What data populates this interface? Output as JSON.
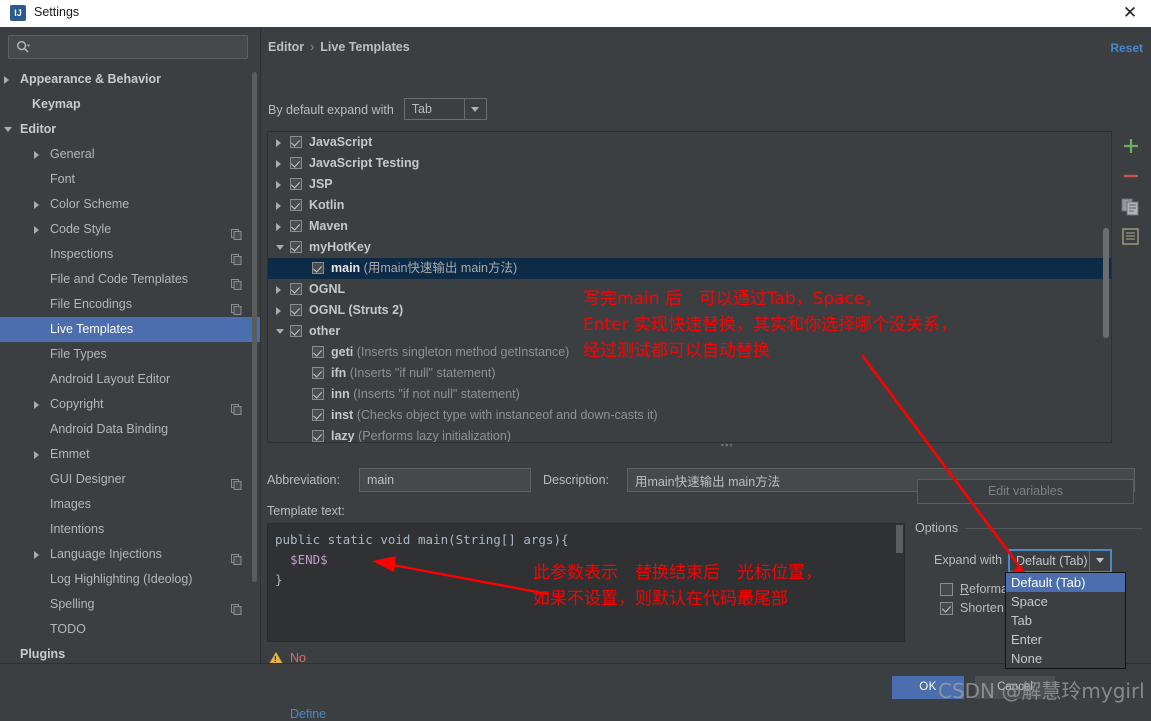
{
  "window": {
    "title": "Settings",
    "logo_text": "IJ",
    "close_label": "✕"
  },
  "sidebar": {
    "search_placeholder": "",
    "search_value": "",
    "items": [
      {
        "label": "Appearance & Behavior",
        "indent": 20,
        "arrow": "right",
        "bold": true,
        "copy": false,
        "selected": false
      },
      {
        "label": "Keymap",
        "indent": 32,
        "arrow": "none",
        "bold": true,
        "copy": false,
        "selected": false
      },
      {
        "label": "Editor",
        "indent": 20,
        "arrow": "down",
        "bold": true,
        "copy": false,
        "selected": false
      },
      {
        "label": "General",
        "indent": 50,
        "arrow": "right",
        "bold": false,
        "copy": false,
        "selected": false
      },
      {
        "label": "Font",
        "indent": 50,
        "arrow": "none",
        "bold": false,
        "copy": false,
        "selected": false
      },
      {
        "label": "Color Scheme",
        "indent": 50,
        "arrow": "right",
        "bold": false,
        "copy": false,
        "selected": false
      },
      {
        "label": "Code Style",
        "indent": 50,
        "arrow": "right",
        "bold": false,
        "copy": true,
        "selected": false
      },
      {
        "label": "Inspections",
        "indent": 50,
        "arrow": "none",
        "bold": false,
        "copy": true,
        "selected": false
      },
      {
        "label": "File and Code Templates",
        "indent": 50,
        "arrow": "none",
        "bold": false,
        "copy": true,
        "selected": false
      },
      {
        "label": "File Encodings",
        "indent": 50,
        "arrow": "none",
        "bold": false,
        "copy": true,
        "selected": false
      },
      {
        "label": "Live Templates",
        "indent": 50,
        "arrow": "none",
        "bold": false,
        "copy": false,
        "selected": true
      },
      {
        "label": "File Types",
        "indent": 50,
        "arrow": "none",
        "bold": false,
        "copy": false,
        "selected": false
      },
      {
        "label": "Android Layout Editor",
        "indent": 50,
        "arrow": "none",
        "bold": false,
        "copy": false,
        "selected": false
      },
      {
        "label": "Copyright",
        "indent": 50,
        "arrow": "right",
        "bold": false,
        "copy": true,
        "selected": false
      },
      {
        "label": "Android Data Binding",
        "indent": 50,
        "arrow": "none",
        "bold": false,
        "copy": false,
        "selected": false
      },
      {
        "label": "Emmet",
        "indent": 50,
        "arrow": "right",
        "bold": false,
        "copy": false,
        "selected": false
      },
      {
        "label": "GUI Designer",
        "indent": 50,
        "arrow": "none",
        "bold": false,
        "copy": true,
        "selected": false
      },
      {
        "label": "Images",
        "indent": 50,
        "arrow": "none",
        "bold": false,
        "copy": false,
        "selected": false
      },
      {
        "label": "Intentions",
        "indent": 50,
        "arrow": "none",
        "bold": false,
        "copy": false,
        "selected": false
      },
      {
        "label": "Language Injections",
        "indent": 50,
        "arrow": "right",
        "bold": false,
        "copy": true,
        "selected": false
      },
      {
        "label": "Log Highlighting (Ideolog)",
        "indent": 50,
        "arrow": "none",
        "bold": false,
        "copy": false,
        "selected": false
      },
      {
        "label": "Spelling",
        "indent": 50,
        "arrow": "none",
        "bold": false,
        "copy": true,
        "selected": false
      },
      {
        "label": "TODO",
        "indent": 50,
        "arrow": "none",
        "bold": false,
        "copy": false,
        "selected": false
      },
      {
        "label": "Plugins",
        "indent": 20,
        "arrow": "none",
        "bold": true,
        "copy": false,
        "selected": false
      }
    ],
    "help_label": "?"
  },
  "header": {
    "breadcrumb_parent": "Editor",
    "breadcrumb_sep": "›",
    "breadcrumb_current": "Live Templates",
    "reset_label": "Reset",
    "expand_label": "By default expand with",
    "expand_value": "Tab"
  },
  "templates_tree": [
    {
      "indent": 22,
      "arrow": "right",
      "name": "JavaScript",
      "desc": "",
      "selected": false
    },
    {
      "indent": 22,
      "arrow": "right",
      "name": "JavaScript Testing",
      "desc": "",
      "selected": false
    },
    {
      "indent": 22,
      "arrow": "right",
      "name": "JSP",
      "desc": "",
      "selected": false
    },
    {
      "indent": 22,
      "arrow": "right",
      "name": "Kotlin",
      "desc": "",
      "selected": false
    },
    {
      "indent": 22,
      "arrow": "right",
      "name": "Maven",
      "desc": "",
      "selected": false
    },
    {
      "indent": 22,
      "arrow": "down",
      "name": "myHotKey",
      "desc": "",
      "selected": false
    },
    {
      "indent": 44,
      "arrow": "none",
      "name": "main",
      "desc": "(用main快速输出 main方法)",
      "selected": true
    },
    {
      "indent": 22,
      "arrow": "right",
      "name": "OGNL",
      "desc": "",
      "selected": false
    },
    {
      "indent": 22,
      "arrow": "right",
      "name": "OGNL (Struts 2)",
      "desc": "",
      "selected": false
    },
    {
      "indent": 22,
      "arrow": "down",
      "name": "other",
      "desc": "",
      "selected": false
    },
    {
      "indent": 44,
      "arrow": "none",
      "name": "geti",
      "desc": "(Inserts singleton method getInstance)",
      "selected": false
    },
    {
      "indent": 44,
      "arrow": "none",
      "name": "ifn",
      "desc": "(Inserts \"if null\" statement)",
      "selected": false
    },
    {
      "indent": 44,
      "arrow": "none",
      "name": "inn",
      "desc": "(Inserts \"if not null\" statement)",
      "selected": false
    },
    {
      "indent": 44,
      "arrow": "none",
      "name": "inst",
      "desc": "(Checks object type with instanceof and down-casts it)",
      "selected": false
    },
    {
      "indent": 44,
      "arrow": "none",
      "name": "lazy",
      "desc": "(Performs lazy initialization)",
      "selected": false
    }
  ],
  "right_toolbar": [
    {
      "name": "add-icon",
      "glyph": "+"
    },
    {
      "name": "remove-icon",
      "glyph": "−"
    },
    {
      "name": "copy-icon",
      "glyph": "⧉"
    },
    {
      "name": "edit-icon",
      "glyph": "▤"
    }
  ],
  "editor": {
    "abbreviation_label": "Abbreviation:",
    "abbreviation_value": "main",
    "description_label": "Description:",
    "description_value": "用main快速输出 main方法",
    "template_text_label": "Template text:",
    "code_line1": "public static void main(String[] args){",
    "code_line2_indent": "  ",
    "code_line2_var": "$END$",
    "code_line3": "}",
    "warning_text": "No applicable contexts yet.",
    "warning_link": "Define"
  },
  "options": {
    "edit_variables_label": "Edit variables",
    "group_label": "Options",
    "expand_with_label": "Expand with",
    "expand_with_value": "Default (Tab)",
    "reformat_label": "Reformat according to style",
    "reformat_checked": false,
    "shorten_label": "Shorten FQ names",
    "shorten_checked": true,
    "dropdown_options": [
      "Default (Tab)",
      "Space",
      "Tab",
      "Enter",
      "None"
    ],
    "dropdown_selected": "Default (Tab)"
  },
  "footer": {
    "ok_label": "OK",
    "cancel_label": "Cancel",
    "watermark": "CSDN @解慧玲mygirl"
  },
  "annotations": {
    "note1_line1": "写完main 后　可以通过Tab，Space，",
    "note1_line2": "Enter 实现快速替换，其实和你选择哪个没关系，",
    "note1_line3": "经过测试都可以自动替换",
    "note2_line1": "此参数表示　替换结束后　光标位置，",
    "note2_line2": "如果不设置，则默认在代码最尾部",
    "arrow_color": "#ff0000"
  }
}
